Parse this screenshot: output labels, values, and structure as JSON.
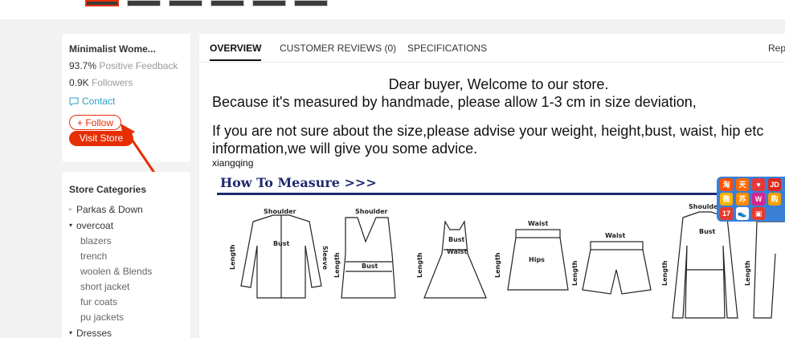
{
  "store": {
    "name": "Minimalist Wome...",
    "feedback_value": "93.7%",
    "feedback_label": "Positive Feedback",
    "followers_value": "0.9K",
    "followers_label": "Followers",
    "contact_label": "Contact",
    "follow_label": "+ Follow",
    "visit_label": "Visit Store"
  },
  "categories": {
    "title": "Store Categories",
    "items": [
      {
        "label": "Parkas & Down"
      },
      {
        "label": "overcoat"
      },
      {
        "label": "Dresses"
      }
    ],
    "overcoat_sub": [
      "blazers",
      "trench",
      "woolen & Blends",
      "short jacket",
      "fur coats",
      "pu jackets"
    ]
  },
  "tabs": {
    "overview": "OVERVIEW",
    "reviews": "CUSTOMER REVIEWS (0)",
    "specs": "SPECIFICATIONS",
    "report": "Rep"
  },
  "content": {
    "line1": "Dear buyer, Welcome to our store.",
    "line2": "Because it's measured by handmade, please allow 1-3 cm in size deviation,",
    "line3": "If you are not sure about the size,please advise your weight, height,bust, waist, hip etc",
    "line4": "information,we will give you some advice.",
    "caption": "xiangqing"
  },
  "measure": {
    "title": "How To Measure >>>",
    "labels": {
      "shoulder": "Shoulder",
      "bust": "Bust",
      "sleeve": "Sleeve",
      "length": "Length",
      "waist": "Waist",
      "hips": "Hips"
    }
  },
  "float_icons": [
    "taobao-icon",
    "tmall-icon",
    "jd-icon",
    "weibo-icon",
    "vip-icon",
    "suning-icon",
    "17-icon",
    "shoe-icon"
  ],
  "colors": {
    "accent": "#e62e04",
    "link": "#2e9cc3",
    "measure_title": "#1e2a6e",
    "float_bar": "#3a7fd6"
  }
}
